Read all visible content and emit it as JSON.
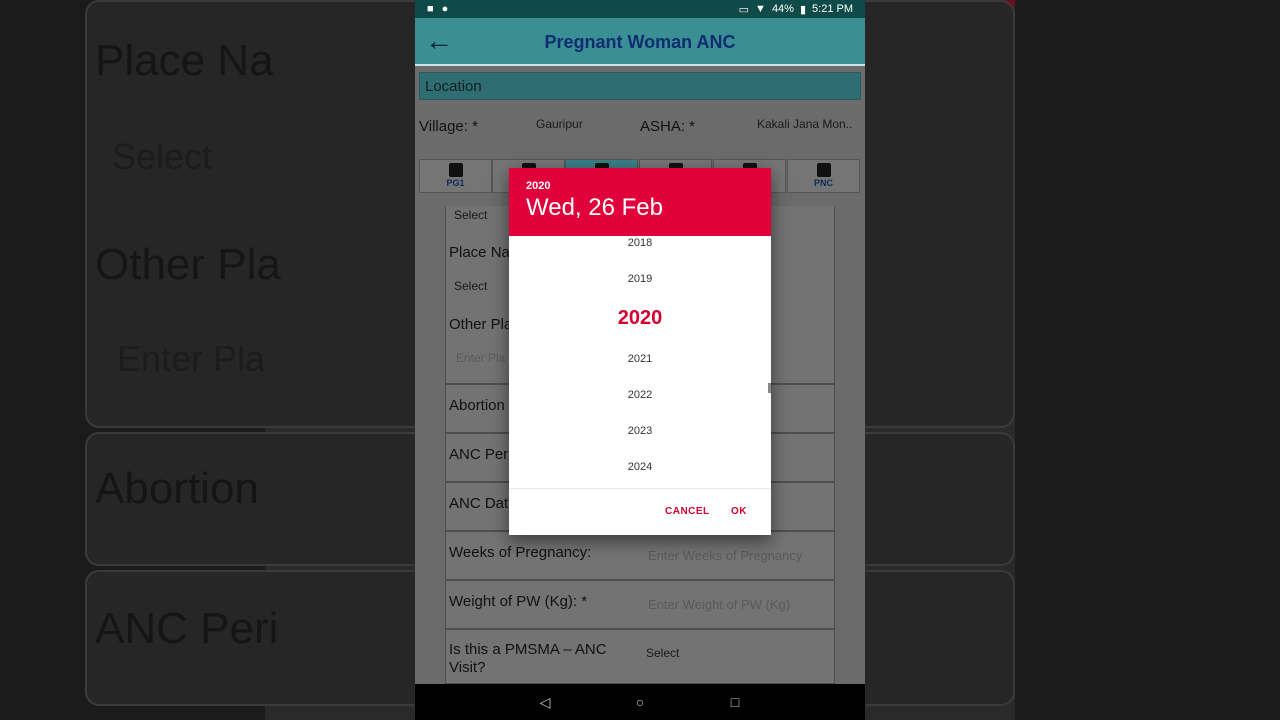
{
  "background": {
    "labels": [
      "Place Na",
      "Select",
      "Other Pla",
      "Enter Pla",
      "Abortion",
      "ANC Peri"
    ]
  },
  "statusbar": {
    "battery": "44%",
    "time": "5:21 PM"
  },
  "appbar": {
    "title": "Pregnant Woman ANC",
    "back_icon": "arrow-left-icon"
  },
  "location": {
    "header": "Location",
    "village_label": "Village: *",
    "village_value": "Gauripur",
    "asha_label": "ASHA: *",
    "asha_value": "Kakali Jana Mon.."
  },
  "tabs": [
    {
      "label": "PG1",
      "icon": "document-icon"
    },
    {
      "label": "",
      "icon": "person-icon"
    },
    {
      "label": "",
      "icon": "pregnant-woman-icon"
    },
    {
      "label": "",
      "icon": "baby-icon"
    },
    {
      "label": "",
      "icon": "mother-icon"
    },
    {
      "label": "PNC",
      "icon": "mother-baby-icon"
    }
  ],
  "form": {
    "select_1": "Select",
    "place_label": "Place Na",
    "select_2": "Select",
    "other_place_label": "Other Pla",
    "other_place_placeholder": "Enter Pla",
    "abortion_label": "Abortion",
    "anc_period_label": "ANC Peri",
    "anc_date_label": "ANC Dat",
    "weeks_label": "Weeks of Pregnancy:",
    "weeks_placeholder": "Enter Weeks of Pregnancy",
    "weight_label": "Weight of PW (Kg): *",
    "weight_placeholder": "Enter Weight of PW (Kg)",
    "pmsma_label_1": "Is this a PMSMA – ANC",
    "pmsma_label_2": "Visit?",
    "pmsma_value": "Select"
  },
  "dialog": {
    "header_year": "2020",
    "header_date": "Wed, 26 Feb",
    "years": [
      "2018",
      "2019",
      "2020",
      "2021",
      "2022",
      "2023",
      "2024"
    ],
    "selected_year": "2020",
    "cancel": "CANCEL",
    "ok": "OK",
    "accent": "#e0003a"
  }
}
